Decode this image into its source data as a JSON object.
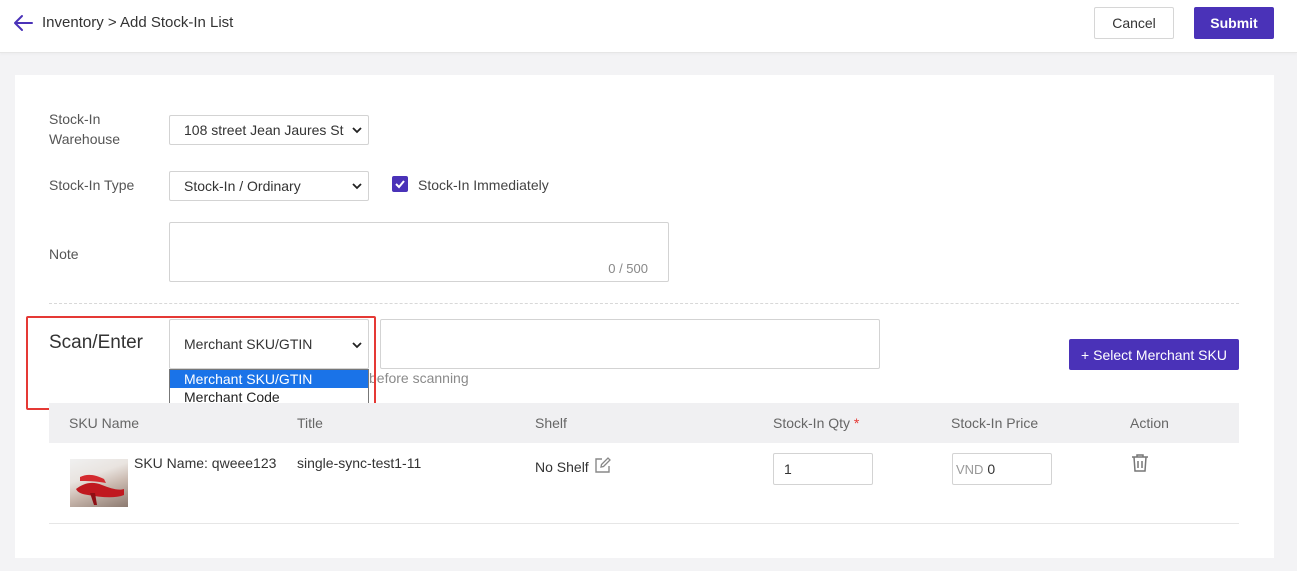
{
  "header": {
    "breadcrumb": "Inventory > Add Stock-In List",
    "cancel_label": "Cancel",
    "submit_label": "Submit"
  },
  "form": {
    "warehouse_label_line1": "Stock-In",
    "warehouse_label_line2": "Warehouse",
    "warehouse_value": "108 street Jean Jaures St",
    "type_label": "Stock-In Type",
    "type_value": "Stock-In / Ordinary",
    "immediate_label": "Stock-In Immediately",
    "immediate_checked": true,
    "note_label": "Note",
    "note_counter": "0 / 500"
  },
  "scan": {
    "label": "Scan/Enter",
    "mode_value": "Merchant SKU/GTIN",
    "options": [
      "Merchant SKU/GTIN",
      "Merchant Code"
    ],
    "hint_text": "before scanning",
    "select_sku_label": "+ Select Merchant SKU"
  },
  "table": {
    "columns": [
      "SKU Name",
      "Title",
      "Shelf",
      "Stock-In Qty",
      "Stock-In Price",
      "Action"
    ],
    "qty_required_mark": "*",
    "rows": [
      {
        "sku_name": "SKU Name: qweee123",
        "title": "single-sync-test1-11",
        "shelf": "No Shelf",
        "qty": "1",
        "currency": "VND",
        "price": "0"
      }
    ]
  },
  "colors": {
    "accent": "#4a32b8",
    "highlight": "#e53935",
    "selected_option": "#1a73e8"
  }
}
